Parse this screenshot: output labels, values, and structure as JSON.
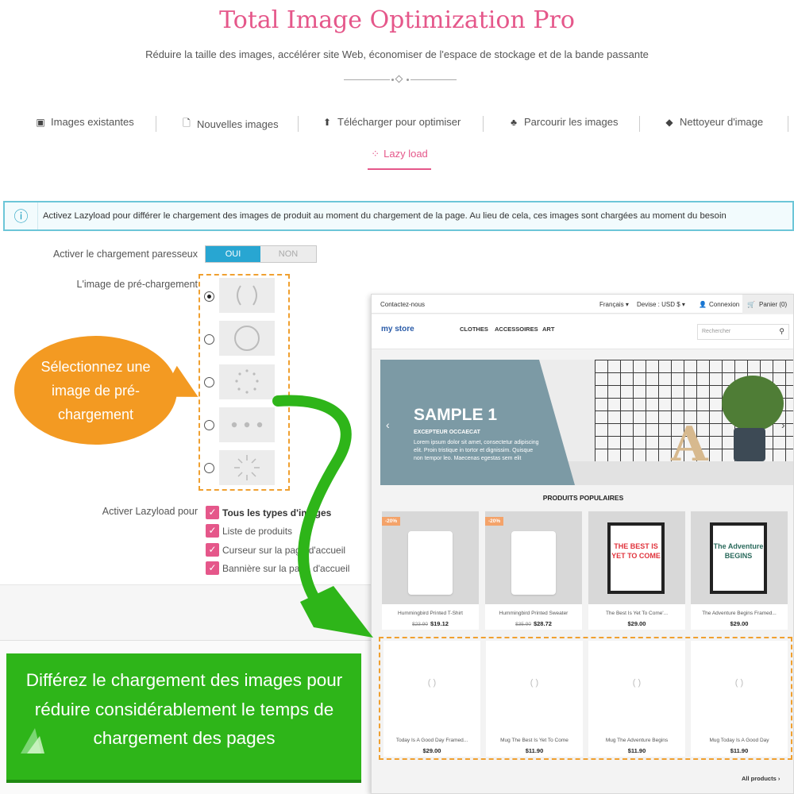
{
  "header": {
    "title": "Total Image Optimization Pro",
    "subtitle": "Réduire la taille des images, accélérer site Web, économiser de l'espace de stockage et de la bande passante"
  },
  "tabs": [
    {
      "label": "Images existantes",
      "icon": "image-icon"
    },
    {
      "label": "Nouvelles images",
      "icon": "file-icon"
    },
    {
      "label": "Télécharger pour optimiser",
      "icon": "upload-icon"
    },
    {
      "label": "Parcourir les images",
      "icon": "sitemap-icon"
    },
    {
      "label": "Nettoyeur d'image",
      "icon": "eraser-icon"
    },
    {
      "label": "Lazy load",
      "icon": "spinner-icon",
      "active": true
    }
  ],
  "alert": {
    "text": "Activez Lazyload pour différer le chargement des images de produit au moment du chargement de la page. Au lieu de cela, ces images sont chargées au moment du besoin"
  },
  "settings": {
    "lazyload_label": "Activer le chargement paresseux",
    "toggle_on": "OUI",
    "toggle_off": "NON",
    "toggle_value": "OUI",
    "preload_label": "L'image de pré-chargement",
    "preload_selected_index": 0,
    "apply_label": "Activer Lazyload pour",
    "checkboxes": [
      {
        "label": "Tous les types d'images",
        "checked": true
      },
      {
        "label": "Liste de produits",
        "checked": true
      },
      {
        "label": "Curseur sur la page d'accueil",
        "checked": true
      },
      {
        "label": "Bannière sur la page d'accueil",
        "checked": true
      }
    ]
  },
  "callouts": {
    "bubble": "Sélectionnez une image de pré-chargement",
    "green": "Différez le chargement des images pour réduire considérablement le temps de chargement des pages"
  },
  "store": {
    "topbar": {
      "contact": "Contactez-nous",
      "language": "Français ▾",
      "currency": "Devise : USD $ ▾",
      "login": "Connexion",
      "cart": "Panier (0)"
    },
    "logo": "my store",
    "nav": [
      "CLOTHES",
      "ACCESSOIRES",
      "ART"
    ],
    "search_placeholder": "Rechercher",
    "hero": {
      "title": "SAMPLE 1",
      "subtitle": "EXCEPTEUR OCCAECAT",
      "text": "Lorem ipsum dolor sit amet, consectetur adipiscing elit. Proin tristique in tortor et dignissim. Quisque non tempor leo. Maecenas egestas sem elit",
      "prev": "‹",
      "next": "›"
    },
    "section_title": "PRODUITS POPULAIRES",
    "products": [
      {
        "name": "Hummingbird Printed T-Shirt",
        "old_price": "$23.90",
        "price": "$19.12",
        "badge": "-20%"
      },
      {
        "name": "Hummingbird Printed Sweater",
        "old_price": "$35.90",
        "price": "$28.72",
        "badge": "-20%"
      },
      {
        "name": "The Best Is Yet To Come'...",
        "price": "$29.00",
        "poster": "THE BEST IS YET TO COME"
      },
      {
        "name": "The Adventure Begins Framed...",
        "price": "$29.00",
        "poster": "The Adventure BEGINS"
      }
    ],
    "lazy_products": [
      {
        "name": "Today Is A Good Day Framed...",
        "price": "$29.00"
      },
      {
        "name": "Mug The Best Is Yet To Come",
        "price": "$11.90"
      },
      {
        "name": "Mug The Adventure Begins",
        "price": "$11.90"
      },
      {
        "name": "Mug Today Is A Good Day",
        "price": "$11.90"
      }
    ],
    "placeholder_glyph": "( )",
    "all_products": "All products ›"
  }
}
